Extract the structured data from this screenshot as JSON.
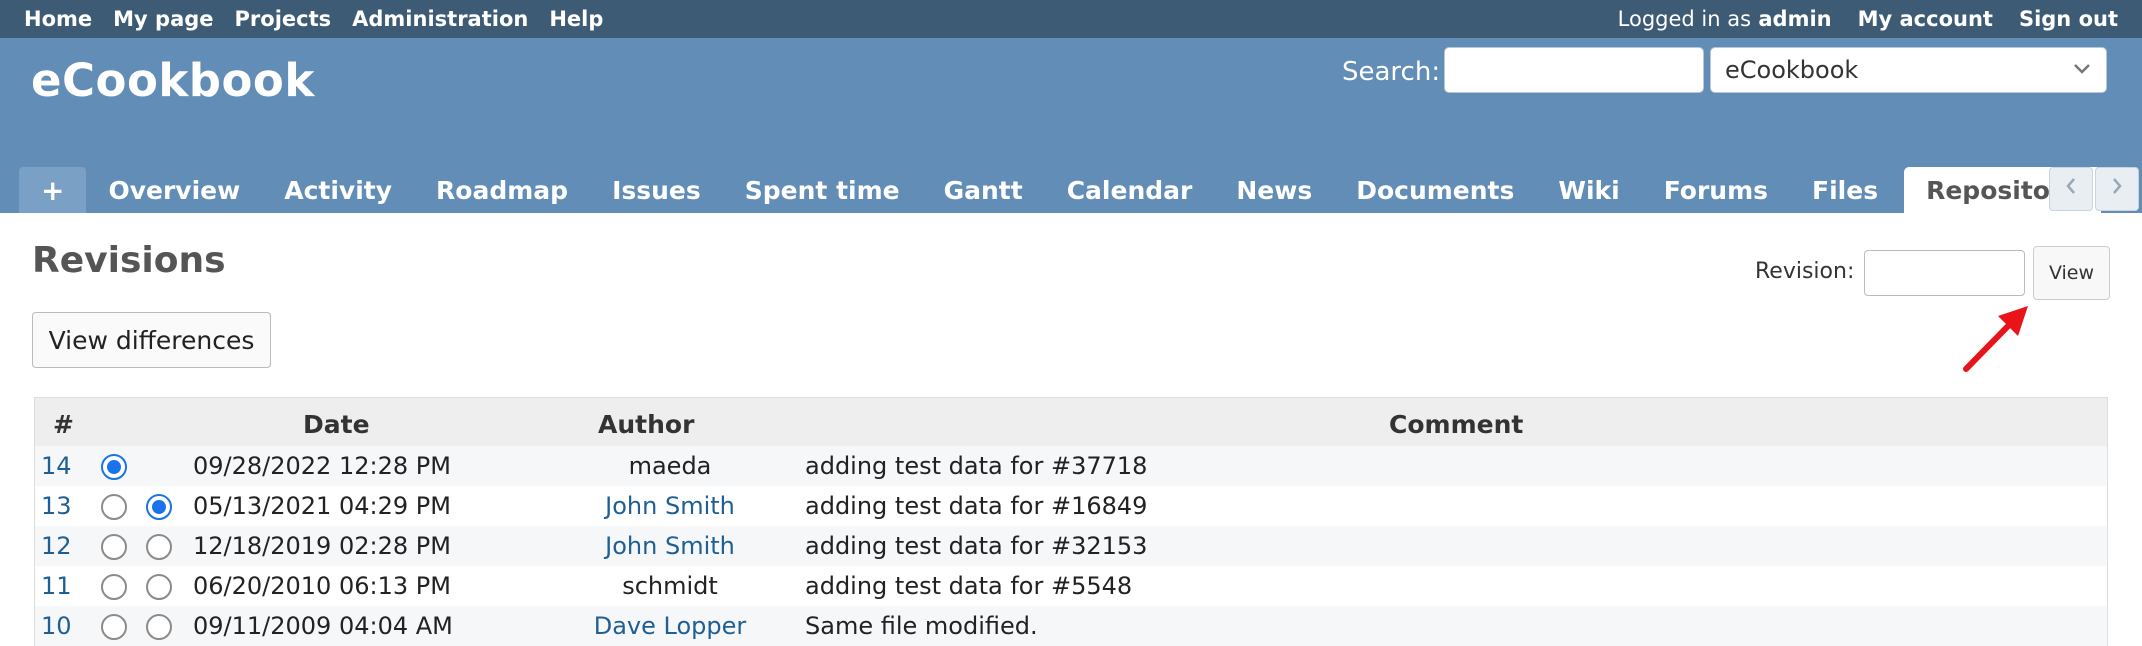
{
  "top_menu": {
    "left": [
      {
        "label": "Home"
      },
      {
        "label": "My page"
      },
      {
        "label": "Projects"
      },
      {
        "label": "Administration"
      },
      {
        "label": "Help"
      }
    ],
    "logged_in_prefix": "Logged in as",
    "logged_in_user": "admin",
    "my_account": "My account",
    "sign_out": "Sign out"
  },
  "header": {
    "project_title": "eCookbook",
    "search_label": "Search:",
    "search_value": "",
    "project_selector": "eCookbook"
  },
  "tabs": {
    "new_label": "+",
    "items": [
      {
        "label": "Overview"
      },
      {
        "label": "Activity"
      },
      {
        "label": "Roadmap"
      },
      {
        "label": "Issues"
      },
      {
        "label": "Spent time"
      },
      {
        "label": "Gantt"
      },
      {
        "label": "Calendar"
      },
      {
        "label": "News"
      },
      {
        "label": "Documents"
      },
      {
        "label": "Wiki"
      },
      {
        "label": "Forums"
      },
      {
        "label": "Files"
      }
    ],
    "selected_label": "Repository",
    "scroll_left_icon": "chevron-left-icon",
    "scroll_right_icon": "chevron-right-icon"
  },
  "content": {
    "title": "Revisions",
    "revision_label": "Revision:",
    "revision_value": "",
    "view_button": "View",
    "view_differences_button": "View differences",
    "annotation_icon": "red-arrow-icon"
  },
  "table": {
    "headers": {
      "number": "#",
      "date": "Date",
      "author": "Author",
      "comment": "Comment"
    },
    "rows": [
      {
        "rev": "14",
        "date": "09/28/2022 12:28 PM",
        "author": "maeda",
        "comment": "adding test data for #37718"
      },
      {
        "rev": "13",
        "date": "05/13/2021 04:29 PM",
        "author": "John Smith",
        "comment": "adding test data for #16849"
      },
      {
        "rev": "12",
        "date": "12/18/2019 02:28 PM",
        "author": "John Smith",
        "comment": "adding test data for #32153"
      },
      {
        "rev": "11",
        "date": "06/20/2010 06:13 PM",
        "author": "schmidt",
        "comment": "adding test data for #5548"
      },
      {
        "rev": "10",
        "date": "09/11/2009 04:04 AM",
        "author": "Dave Lopper",
        "comment": "Same file modified."
      }
    ]
  },
  "colors": {
    "top_menu_bg": "#3e5b76",
    "header_bg": "#628db6",
    "link": "#1f5f94",
    "radio_checked": "#1a73e8",
    "annotation": "#e8141a"
  }
}
